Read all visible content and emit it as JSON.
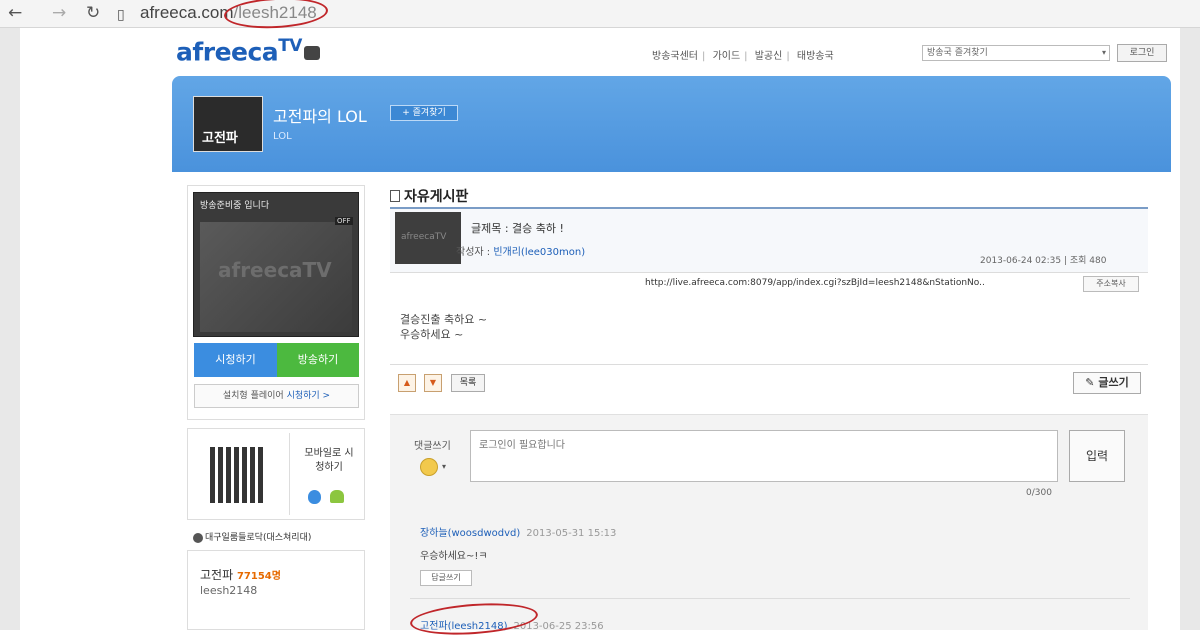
{
  "browser": {
    "url_domain": "afreeca.com",
    "url_path": "/leesh2148"
  },
  "header": {
    "logo": "afreeca",
    "logo_tv": "TV",
    "menu": [
      "방송국센터",
      "가이드",
      "발공신",
      "태방송국"
    ],
    "favorite_select": "방송국 즐겨찾기",
    "go_button": "로그인"
  },
  "channel": {
    "title": "고전파의 LOL",
    "follow_button": "+ 즐겨찾기",
    "subtitle": "LOL",
    "thumb_label": "고전파"
  },
  "player": {
    "status": "방송준비중 입니다",
    "badge": "OFF",
    "logo": "afreecaTV",
    "watch_button": "시청하기",
    "broadcast_button": "방송하기",
    "installed_player_prefix": "설치형 플레이어",
    "installed_player_link": "시청하기 >"
  },
  "mobile": {
    "label": "모바일로 시청하기"
  },
  "sidebar": {
    "club_link": "대구일룸들로닥(대스쳐리대)",
    "profile_name": "고전파",
    "profile_fans": "77154명",
    "profile_id": "leesh2148"
  },
  "board": {
    "title": "자유게시판",
    "thumb_text": "afreecaTV",
    "subject": "글제목 : 결승 축하 !",
    "author_prefix": "작성자 : ",
    "author": "빈개리(lee030mon)",
    "date_views": "2013-06-24 02:35 | 조회 480",
    "url": "http://live.afreeca.com:8079/app/index.cgi?szBjId=leesh2148&nStationNo..",
    "copy_url_button": "주소복사",
    "body": [
      "결승진출 축하요 ~",
      "우승하세요 ~"
    ],
    "vote_up": "▲",
    "vote_down": "▼",
    "list_button": "목록",
    "write_button": "글쓰기"
  },
  "comments": {
    "label": "댓글쓰기",
    "input_placeholder": "로그인이 필요합니다",
    "submit_button": "입력",
    "char_count": "0/300",
    "items": [
      {
        "author": "장하늘(woosdwodvd)",
        "date": "2013-05-31 15:13",
        "text": "우승하세요~!ㅋ",
        "reply": "답글쓰기"
      },
      {
        "author": "고전파(leesh2148)",
        "date": "2013-06-25 23:56"
      }
    ]
  },
  "colors": {
    "brand": "#1d5fb8",
    "banner": "#4a92dc",
    "watch": "#3b8de0",
    "broadcast": "#4cb93f",
    "annotation": "#c0262a"
  }
}
